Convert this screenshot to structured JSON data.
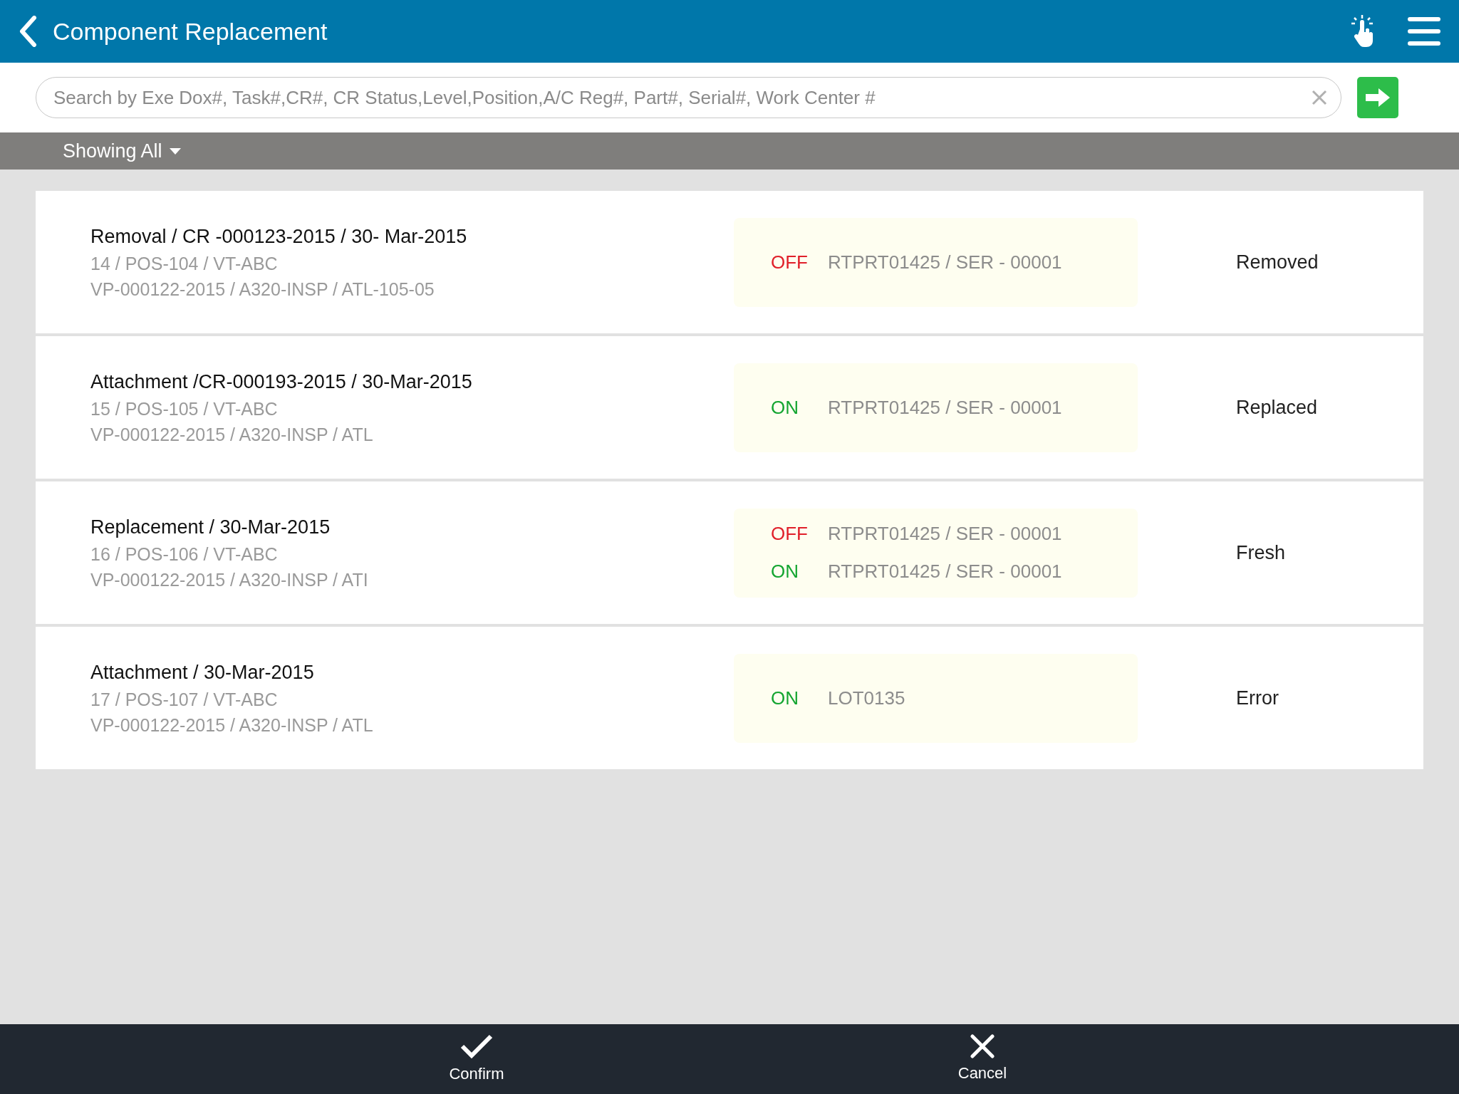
{
  "header": {
    "title": "Component Replacement"
  },
  "search": {
    "placeholder": "Search by Exe Dox#, Task#,CR#, CR Status,Level,Position,A/C Reg#, Part#, Serial#, Work Center #"
  },
  "filter": {
    "label": "Showing All"
  },
  "records": [
    {
      "title": "Removal / CR -000123-2015 / 30- Mar-2015",
      "line_1": "14 / POS-104 / VT-ABC",
      "line_2": "VP-000122-2015 / A320-INSP / ATL-105-05",
      "parts": [
        {
          "kind": "off",
          "tag": "OFF",
          "part": "RTPRT01425 / SER - 00001"
        }
      ],
      "status": "Removed"
    },
    {
      "title": "Attachment /CR-000193-2015 / 30-Mar-2015",
      "line_1": "15 / POS-105 / VT-ABC",
      "line_2": "VP-000122-2015 / A320-INSP / ATL",
      "parts": [
        {
          "kind": "on",
          "tag": "ON",
          "part": "RTPRT01425 / SER - 00001"
        }
      ],
      "status": "Replaced"
    },
    {
      "title": "Replacement / 30-Mar-2015",
      "line_1": "16 / POS-106 / VT-ABC",
      "line_2": "VP-000122-2015 / A320-INSP / ATI",
      "parts": [
        {
          "kind": "off",
          "tag": "OFF",
          "part": "RTPRT01425 / SER - 00001"
        },
        {
          "kind": "on",
          "tag": "ON",
          "part": "RTPRT01425 / SER - 00001"
        }
      ],
      "status": "Fresh"
    },
    {
      "title": "Attachment / 30-Mar-2015",
      "line_1": "17 / POS-107 / VT-ABC",
      "line_2": "VP-000122-2015 / A320-INSP / ATL",
      "parts": [
        {
          "kind": "on",
          "tag": "ON",
          "part": "LOT0135"
        }
      ],
      "status": "Error"
    }
  ],
  "actions": [
    {
      "kind": "confirm",
      "label": "Confirm"
    },
    {
      "kind": "cancel",
      "label": "Cancel"
    }
  ]
}
